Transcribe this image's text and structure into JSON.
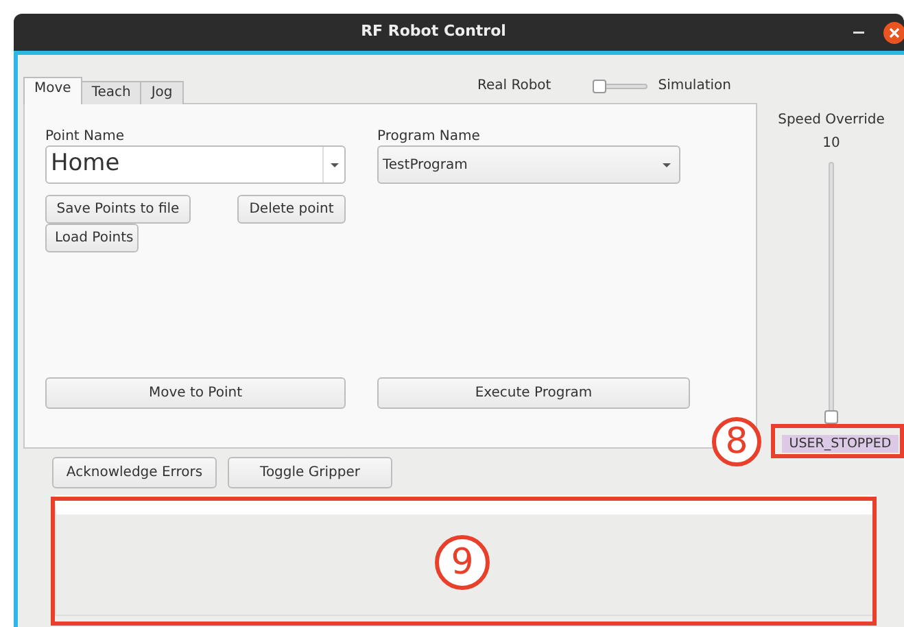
{
  "window": {
    "title": "RF Robot Control"
  },
  "tabs": [
    {
      "label": "Move",
      "selected": true
    },
    {
      "label": "Teach",
      "selected": false
    },
    {
      "label": "Jog",
      "selected": false
    }
  ],
  "mode_switch": {
    "left_label": "Real Robot",
    "right_label": "Simulation",
    "on": false
  },
  "point_name": {
    "label": "Point Name",
    "value": "Home"
  },
  "program_name": {
    "label": "Program Name",
    "value": "TestProgram"
  },
  "point_buttons": [
    "Save Points to file",
    "Delete point",
    "Load Points"
  ],
  "move_button": "Move to Point",
  "execute_button": "Execute Program",
  "speed_override": {
    "label": "Speed Override",
    "reading": "10",
    "level": 0
  },
  "status": "USER_STOPPED",
  "bottom_buttons": [
    "Acknowledge Errors",
    "Toggle Gripper"
  ],
  "annotations": [
    {
      "label": "8"
    },
    {
      "label": "9"
    }
  ]
}
